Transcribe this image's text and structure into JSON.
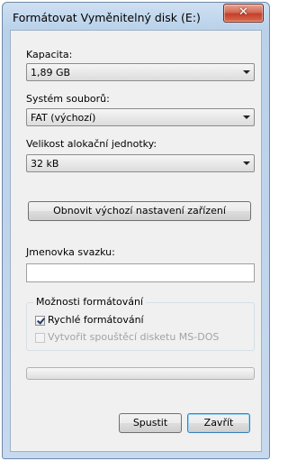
{
  "window": {
    "title": "Formátovat Vyměnitelný disk (E:)",
    "close_glyph": "✕"
  },
  "capacity": {
    "label": "Kapacita:",
    "value": "1,89 GB"
  },
  "filesystem": {
    "label": "Systém souborů:",
    "value": "FAT (výchozí)"
  },
  "allocation": {
    "label": "Velikost alokační jednotky:",
    "value": "32 kB"
  },
  "restore_defaults_label": "Obnovit výchozí nastavení zařízení",
  "volume_label": {
    "label": "Jmenovka svazku:",
    "value": ""
  },
  "format_options": {
    "title": "Možnosti formátování",
    "quick_format": {
      "label": "Rychlé formátování",
      "checked": true
    },
    "msdos_boot": {
      "label": "Vytvořit spouštěcí disketu MS-DOS",
      "checked": false,
      "enabled": false
    }
  },
  "progress": {
    "value": 0
  },
  "buttons": {
    "start": "Spustit",
    "close": "Zavřít"
  }
}
